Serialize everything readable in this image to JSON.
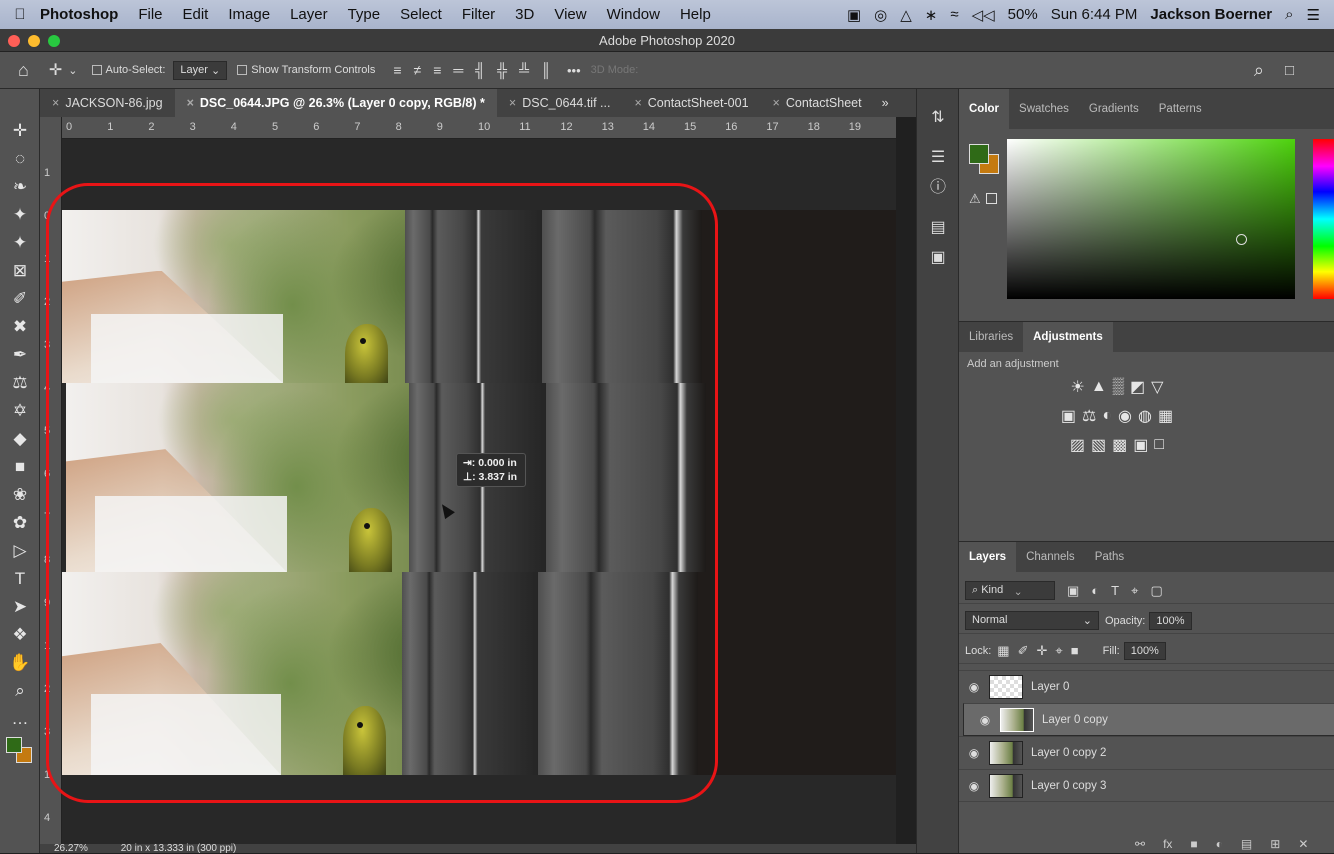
{
  "menubar": {
    "apple": "",
    "app": "Photoshop",
    "items": [
      "File",
      "Edit",
      "Image",
      "Layer",
      "Type",
      "Select",
      "Filter",
      "3D",
      "View",
      "Window",
      "Help"
    ],
    "status_icons": [
      "▣",
      "◎",
      "△",
      "∗",
      "≈",
      "◁◁"
    ],
    "battery": "50%",
    "time": "Sun 6:44 PM",
    "user": "Jackson Boerner",
    "search_icon": "⌕",
    "list_icon": "☰"
  },
  "window": {
    "title": "Adobe Photoshop 2020",
    "close_color": "#ff5f57",
    "min_color": "#febc2e",
    "max_color": "#28c840"
  },
  "options": {
    "home_icon": "⌂",
    "move_icon": "✛",
    "auto_select_label": "Auto-Select:",
    "auto_select_value": "Layer",
    "transform_label": "Show Transform Controls",
    "align_icons": [
      "≡",
      "≠",
      "≡",
      "═",
      "╣",
      "╬",
      "╩",
      "║"
    ],
    "more": "•••",
    "mode_3d": "3D Mode:",
    "search_icon": "⌕",
    "view_icon": "□"
  },
  "tabs": [
    {
      "label": "JACKSON-86.jpg",
      "active": false
    },
    {
      "label": "DSC_0644.JPG @ 26.3% (Layer 0 copy, RGB/8) *",
      "active": true
    },
    {
      "label": "DSC_0644.tif ...",
      "active": false
    },
    {
      "label": "ContactSheet-001",
      "active": false
    },
    {
      "label": "ContactSheet",
      "active": false
    }
  ],
  "tab_close": "×",
  "tab_overflow": "»",
  "rulers": {
    "top": [
      "0",
      "1",
      "2",
      "3",
      "4",
      "5",
      "6",
      "7",
      "8",
      "9",
      "10",
      "11",
      "12",
      "13",
      "14",
      "15",
      "16",
      "17",
      "18",
      "19"
    ],
    "left": [
      "1",
      "0",
      "1",
      "2",
      "3",
      "4",
      "5",
      "6",
      "7",
      "8",
      "9",
      "1",
      "2",
      "3",
      "1",
      "4"
    ]
  },
  "tools": [
    "✛",
    "◌",
    "❧",
    "✦",
    "✦",
    "⊠",
    "✐",
    "✖",
    "✒",
    "⚖",
    "✡",
    "◆",
    "■",
    "❀",
    "✿",
    "▷",
    "T",
    "➤",
    "❖",
    "✋",
    "⌕",
    "…"
  ],
  "tool_bottom_icons": [
    "■",
    "⇅"
  ],
  "fg_color": "#2f6a17",
  "bg_color": "#c47a10",
  "tooltip": {
    "line1": "⇥: 0.000 in",
    "line2": "⊥: 3.837 in"
  },
  "status": {
    "zoom": "26.27%",
    "doc": "20 in x 13.333 in (300 ppi)"
  },
  "panel_icons": [
    "⇅",
    "☰",
    "ⓘ",
    "▤",
    "▣"
  ],
  "color_panel": {
    "tabs": [
      "Color",
      "Swatches",
      "Gradients",
      "Patterns"
    ],
    "warning_icon": "⚠"
  },
  "adjustments_panel": {
    "tabs": [
      "Libraries",
      "Adjustments"
    ],
    "add_label": "Add an adjustment",
    "rows": [
      [
        "☀",
        "▲",
        "▒",
        "◩",
        "▽"
      ],
      [
        "▣",
        "⚖",
        "◐",
        "◉",
        "◍",
        "▦"
      ],
      [
        "▨",
        "▧",
        "▩",
        "▣",
        "□"
      ]
    ]
  },
  "layers_panel": {
    "tabs": [
      "Layers",
      "Channels",
      "Paths"
    ],
    "kind": "Kind",
    "filter_icons": [
      "▣",
      "◐",
      "T",
      "⌖",
      "▢"
    ],
    "blend_mode": "Normal",
    "opacity_label": "Opacity:",
    "opacity_value": "100%",
    "lock_label": "Lock:",
    "lock_icons": [
      "▦",
      "✐",
      "✛",
      "⌖",
      "■"
    ],
    "fill_label": "Fill:",
    "fill_value": "100%",
    "eye_icon": "◉",
    "layers": [
      {
        "name": "Layer 0",
        "selected": false,
        "thumb": "transparent"
      },
      {
        "name": "Layer 0 copy",
        "selected": true,
        "thumb": "photo"
      },
      {
        "name": "Layer 0 copy 2",
        "selected": false,
        "thumb": "photo"
      },
      {
        "name": "Layer 0 copy 3",
        "selected": false,
        "thumb": "photo"
      }
    ],
    "bottom_icons": [
      "⚯",
      "fx",
      "■",
      "◐",
      "▤",
      "⊞",
      "✕"
    ]
  }
}
